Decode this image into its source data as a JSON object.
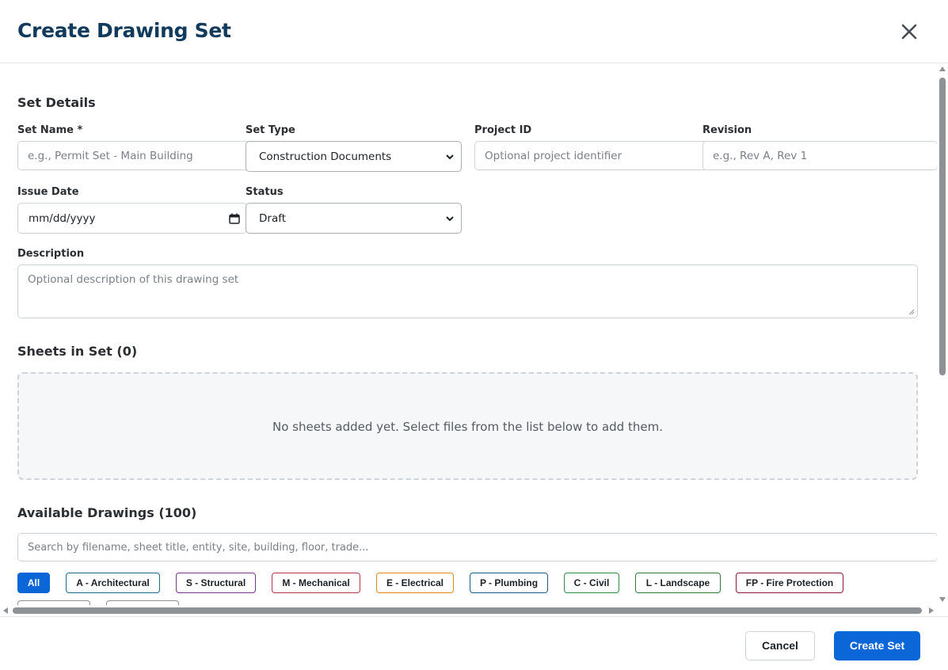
{
  "dialog": {
    "title": "Create Drawing Set",
    "close_icon": "close-icon"
  },
  "details": {
    "section_title": "Set Details",
    "set_name": {
      "label": "Set Name *",
      "placeholder": "e.g., Permit Set - Main Building",
      "value": ""
    },
    "set_type": {
      "label": "Set Type",
      "selected": "Construction Documents"
    },
    "project_id": {
      "label": "Project ID",
      "placeholder": "Optional project identifier",
      "value": ""
    },
    "revision": {
      "label": "Revision",
      "placeholder": "e.g., Rev A, Rev 1",
      "value": ""
    },
    "issue_date": {
      "label": "Issue Date",
      "value": "mm/dd/yyyy"
    },
    "status": {
      "label": "Status",
      "selected": "Draft"
    },
    "description": {
      "label": "Description",
      "placeholder": "Optional description of this drawing set"
    }
  },
  "sheets": {
    "section_title": "Sheets in Set (0)",
    "empty_message": "No sheets added yet. Select files from the list below to add them."
  },
  "available": {
    "section_title": "Available Drawings (100)",
    "search_placeholder": "Search by filename, sheet title, entity, site, building, floor, trade...",
    "filters": [
      {
        "label": "All",
        "active": true,
        "color": "#0b66d8"
      },
      {
        "label": "A - Architectural",
        "active": false,
        "color": "#1a6c8a"
      },
      {
        "label": "S - Structural",
        "active": false,
        "color": "#6b3a8a"
      },
      {
        "label": "M - Mechanical",
        "active": false,
        "color": "#b23a48"
      },
      {
        "label": "E - Electrical",
        "active": false,
        "color": "#d98a1c"
      },
      {
        "label": "P - Plumbing",
        "active": false,
        "color": "#1a5c8a"
      },
      {
        "label": "C - Civil",
        "active": false,
        "color": "#2e8a4a"
      },
      {
        "label": "L - Landscape",
        "active": false,
        "color": "#2e7a3a"
      },
      {
        "label": "FP - Fire Protection",
        "active": false,
        "color": "#8a1a3a"
      }
    ]
  },
  "footer": {
    "cancel_label": "Cancel",
    "create_label": "Create Set"
  }
}
